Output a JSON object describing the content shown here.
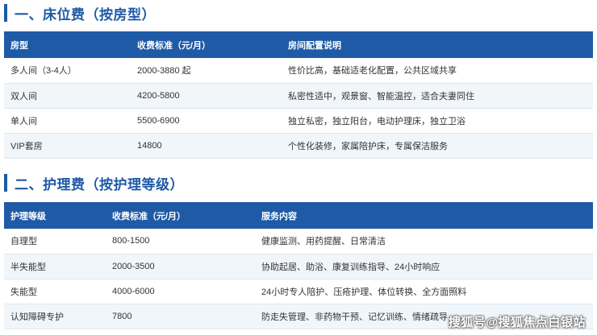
{
  "section1": {
    "title": "一、床位费（按房型）",
    "headers": [
      "房型",
      "收费标准（元/月）",
      "房间配置说明"
    ],
    "rows": [
      [
        "多人间（3-4人）",
        "2000-3880 起",
        "性价比高，基础适老化配置，公共区域共享"
      ],
      [
        "双人间",
        "4200-5800",
        "私密性适中，观景窗、智能温控，适合夫妻同住"
      ],
      [
        "单人间",
        "5500-6900",
        "独立私密，独立阳台，电动护理床，独立卫浴"
      ],
      [
        "VIP套房",
        "14800",
        "个性化装修，家属陪护床，专属保洁服务"
      ]
    ]
  },
  "section2": {
    "title": "二、护理费（按护理等级）",
    "headers": [
      "护理等级",
      "收费标准（元/月）",
      "服务内容"
    ],
    "rows": [
      [
        "自理型",
        "800-1500",
        "健康监测、用药提醒、日常清洁"
      ],
      [
        "半失能型",
        "2000-3500",
        "协助起居、助浴、康复训练指导、24小时响应"
      ],
      [
        "失能型",
        "4000-6000",
        "24小时专人陪护、压疮护理、体位转换、全方面照料"
      ],
      [
        "认知障碍专护",
        "7800",
        "防走失管理、非药物干预、记忆训练、情绪疏导"
      ]
    ]
  },
  "watermark": "搜狐号@搜狐焦点白银站",
  "colors": {
    "accent": "#1f5aa6",
    "row_alt": "#f1f6fb"
  }
}
